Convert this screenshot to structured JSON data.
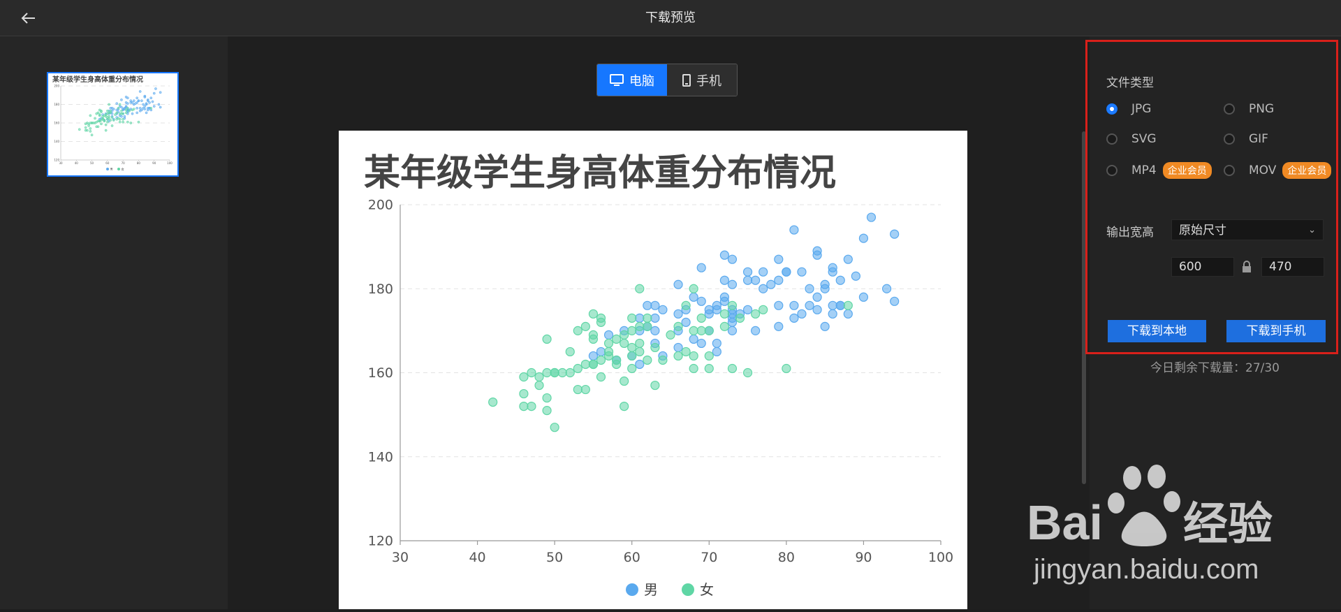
{
  "header": {
    "title": "下载预览",
    "back_icon": "arrow-left-icon"
  },
  "device_toggle": {
    "desktop_label": "电脑",
    "mobile_label": "手机",
    "active": "desktop"
  },
  "thumbnail": {
    "title": "某年级学生身高体重分布情况"
  },
  "options": {
    "file_type_label": "文件类型",
    "file_types": [
      {
        "label": "JPG",
        "checked": true,
        "badge": ""
      },
      {
        "label": "PNG",
        "checked": false,
        "badge": ""
      },
      {
        "label": "SVG",
        "checked": false,
        "badge": ""
      },
      {
        "label": "GIF",
        "checked": false,
        "badge": ""
      },
      {
        "label": "MP4",
        "checked": false,
        "badge": "企业会员"
      },
      {
        "label": "MOV",
        "checked": false,
        "badge": "企业会员"
      }
    ],
    "size_label": "输出宽高",
    "size_select": "原始尺寸",
    "width": "600",
    "height": "470",
    "download_local": "下载到本地",
    "download_mobile": "下载到手机",
    "quota": "今日剩余下载量：27/30"
  },
  "colors": {
    "accent": "#1677ff",
    "male": "#5aa9ee",
    "female": "#5fd6a5",
    "badge": "#f08a24",
    "frame": "#d9201a"
  },
  "watermark": {
    "brand": "Baidu经验",
    "url": "jingyan.baidu.com"
  },
  "chart_data": {
    "type": "scatter",
    "title": "某年级学生身高体重分布情况",
    "xlabel": "",
    "ylabel": "",
    "xlim": [
      30,
      100
    ],
    "ylim": [
      120,
      200
    ],
    "xticks": [
      30,
      40,
      50,
      60,
      70,
      80,
      90,
      100
    ],
    "yticks": [
      120,
      140,
      160,
      180,
      200
    ],
    "grid": "horizontal-dashed",
    "legend_position": "bottom-center",
    "series": [
      {
        "name": "男",
        "color": "#5aa9ee",
        "points": [
          [
            91,
            197
          ],
          [
            81,
            194
          ],
          [
            94,
            193
          ],
          [
            90,
            192
          ],
          [
            84,
            189
          ],
          [
            72,
            188
          ],
          [
            84,
            188
          ],
          [
            79,
            187
          ],
          [
            88,
            187
          ],
          [
            73,
            187
          ],
          [
            69,
            185
          ],
          [
            86,
            185
          ],
          [
            77,
            184
          ],
          [
            82,
            184
          ],
          [
            80,
            184
          ],
          [
            75,
            184
          ],
          [
            86,
            184
          ],
          [
            80,
            184
          ],
          [
            89,
            183
          ],
          [
            87,
            182
          ],
          [
            72,
            182
          ],
          [
            75,
            182
          ],
          [
            79,
            182
          ],
          [
            76,
            182
          ],
          [
            66,
            181
          ],
          [
            78,
            181
          ],
          [
            73,
            181
          ],
          [
            85,
            181
          ],
          [
            83,
            180
          ],
          [
            77,
            180
          ],
          [
            93,
            180
          ],
          [
            85,
            180
          ],
          [
            68,
            178
          ],
          [
            90,
            178
          ],
          [
            69,
            177
          ],
          [
            72,
            178
          ],
          [
            84,
            178
          ],
          [
            94,
            177
          ],
          [
            72,
            177
          ],
          [
            79,
            176
          ],
          [
            83,
            176
          ],
          [
            71,
            176
          ],
          [
            87,
            176
          ],
          [
            87,
            176
          ],
          [
            62,
            176
          ],
          [
            63,
            176
          ],
          [
            81,
            176
          ],
          [
            86,
            176
          ],
          [
            70,
            175
          ],
          [
            67,
            175
          ],
          [
            75,
            175
          ],
          [
            71,
            175
          ],
          [
            84,
            175
          ],
          [
            64,
            175
          ],
          [
            73,
            175
          ],
          [
            66,
            174
          ],
          [
            73,
            174
          ],
          [
            86,
            174
          ],
          [
            88,
            174
          ],
          [
            74,
            174
          ],
          [
            81,
            173
          ],
          [
            82,
            174
          ],
          [
            70,
            174
          ],
          [
            73,
            173
          ],
          [
            63,
            173
          ],
          [
            61,
            173
          ],
          [
            67,
            172
          ],
          [
            73,
            172
          ],
          [
            85,
            171
          ],
          [
            62,
            171
          ],
          [
            79,
            171
          ],
          [
            59,
            170
          ],
          [
            61,
            170
          ],
          [
            63,
            170
          ],
          [
            66,
            170
          ],
          [
            70,
            170
          ],
          [
            73,
            170
          ],
          [
            76,
            170
          ],
          [
            57,
            169
          ],
          [
            68,
            168
          ],
          [
            63,
            167
          ],
          [
            69,
            167
          ],
          [
            71,
            167
          ],
          [
            66,
            166
          ],
          [
            56,
            165
          ],
          [
            71,
            165
          ],
          [
            60,
            164
          ],
          [
            64,
            164
          ],
          [
            55,
            164
          ],
          [
            58,
            163
          ],
          [
            61,
            162
          ]
        ]
      },
      {
        "name": "女",
        "color": "#5fd6a5",
        "points": [
          [
            61,
            180
          ],
          [
            68,
            180
          ],
          [
            67,
            176
          ],
          [
            73,
            176
          ],
          [
            88,
            176
          ],
          [
            77,
            175
          ],
          [
            55,
            174
          ],
          [
            76,
            174
          ],
          [
            72,
            174
          ],
          [
            60,
            173
          ],
          [
            56,
            173
          ],
          [
            62,
            173
          ],
          [
            69,
            173
          ],
          [
            74,
            173
          ],
          [
            56,
            172
          ],
          [
            54,
            171
          ],
          [
            62,
            171
          ],
          [
            66,
            171
          ],
          [
            72,
            171
          ],
          [
            68,
            170
          ],
          [
            69,
            170
          ],
          [
            70,
            170
          ],
          [
            53,
            170
          ],
          [
            60,
            170
          ],
          [
            59,
            169
          ],
          [
            55,
            169
          ],
          [
            58,
            168
          ],
          [
            65,
            169
          ],
          [
            49,
            168
          ],
          [
            55,
            168
          ],
          [
            57,
            167
          ],
          [
            59,
            167
          ],
          [
            61,
            167
          ],
          [
            63,
            166
          ],
          [
            60,
            166
          ],
          [
            57,
            165
          ],
          [
            61,
            165
          ],
          [
            52,
            165
          ],
          [
            67,
            165
          ],
          [
            70,
            164
          ],
          [
            60,
            164
          ],
          [
            56,
            163
          ],
          [
            58,
            163
          ],
          [
            62,
            163
          ],
          [
            66,
            164
          ],
          [
            68,
            164
          ],
          [
            58,
            162
          ],
          [
            54,
            162
          ],
          [
            55,
            162
          ],
          [
            53,
            161
          ],
          [
            60,
            161
          ],
          [
            68,
            161
          ],
          [
            73,
            161
          ],
          [
            75,
            160
          ],
          [
            80,
            161
          ],
          [
            70,
            161
          ],
          [
            47,
            160
          ],
          [
            50,
            160
          ],
          [
            51,
            160
          ],
          [
            48,
            159
          ],
          [
            50,
            160
          ],
          [
            46,
            159
          ],
          [
            52,
            160
          ],
          [
            49,
            160
          ],
          [
            56,
            159
          ],
          [
            59,
            158
          ],
          [
            63,
            157
          ],
          [
            48,
            157
          ],
          [
            53,
            156
          ],
          [
            54,
            156
          ],
          [
            46,
            155
          ],
          [
            49,
            154
          ],
          [
            46,
            152
          ],
          [
            47,
            152
          ],
          [
            59,
            152
          ],
          [
            42,
            153
          ],
          [
            49,
            151
          ],
          [
            50,
            147
          ],
          [
            55,
            162
          ],
          [
            57,
            164
          ],
          [
            61,
            171
          ],
          [
            64,
            163
          ]
        ]
      }
    ]
  }
}
